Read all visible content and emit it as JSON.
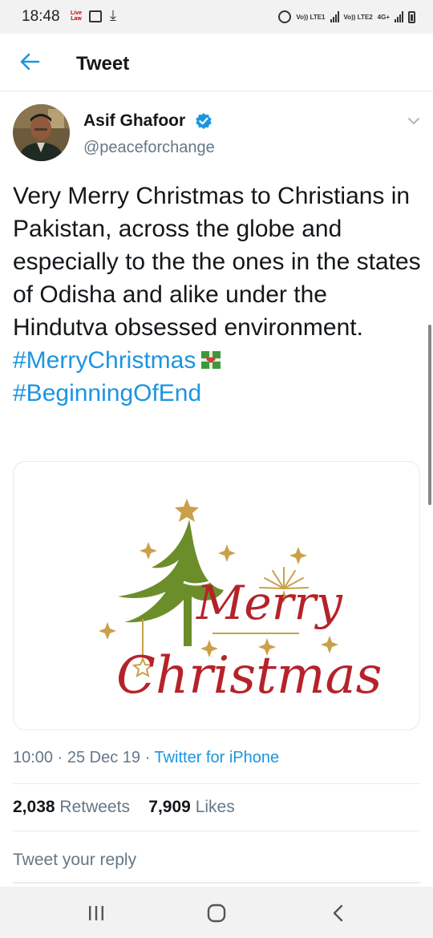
{
  "status_bar": {
    "time": "18:48",
    "notification_icons": [
      "live-law-icon",
      "gallery-icon",
      "download-icon"
    ],
    "live_label": "Live Law",
    "sim1": "Vo)) LTE1",
    "sim2": "Vo)) LTE2",
    "network": "4G+"
  },
  "header": {
    "title": "Tweet",
    "back_icon": "arrow-left-icon"
  },
  "tweet": {
    "author_name": "Asif Ghafoor",
    "author_handle": "@peaceforchange",
    "verified": true,
    "text": "Very Merry Christmas to Christians in Pakistan, across the globe and especially to the the ones in the states of Odisha and alike under the Hindutva obsessed environment.",
    "hashtag1": "#MerryChristmas",
    "hashtag2": "#BeginningOfEnd",
    "emoji": "gift-icon",
    "image_caption_line1": "Merry",
    "image_caption_line2": "Christmas",
    "time": "10:00",
    "date": "25 Dec 19",
    "separator": "·",
    "source": "Twitter for iPhone",
    "retweets_count": "2,038",
    "retweets_label": "Retweets",
    "likes_count": "7,909",
    "likes_label": "Likes"
  },
  "reply": {
    "placeholder": "Tweet your reply"
  },
  "colors": {
    "accent": "#1b95e0",
    "muted": "#657786",
    "text": "#14171a",
    "christmas_red": "#b5232a",
    "tree_green": "#6b8e2a",
    "star_gold": "#c9a14a"
  }
}
